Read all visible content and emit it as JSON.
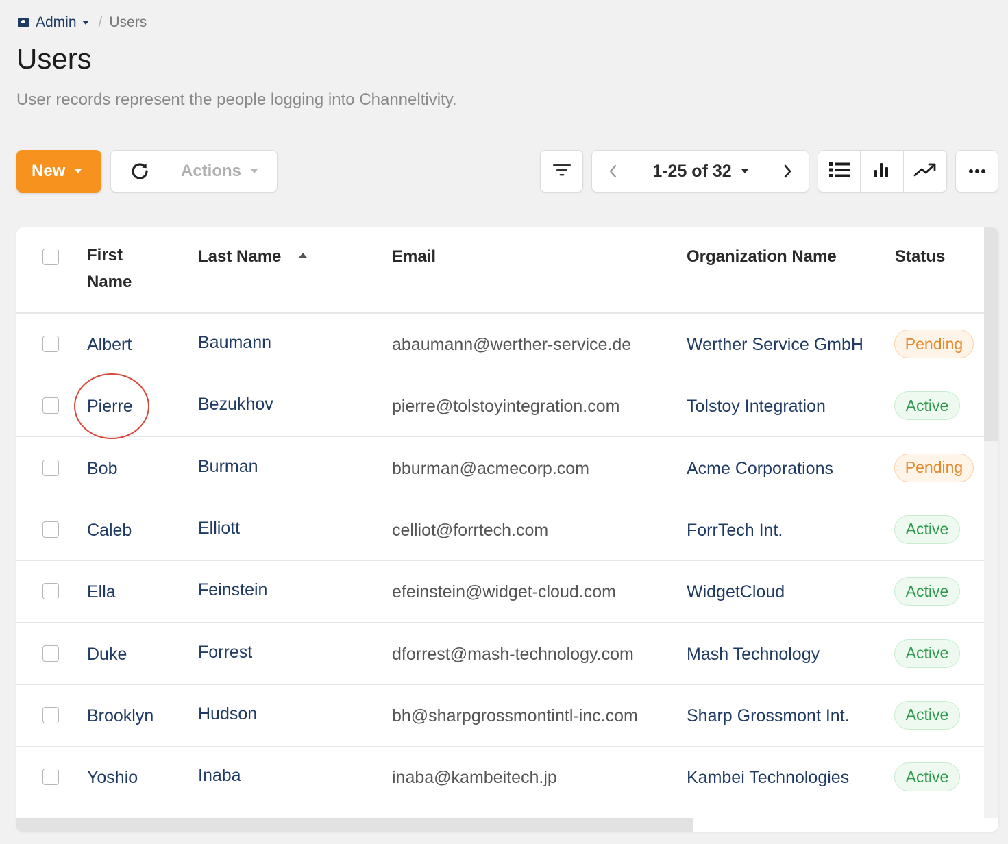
{
  "breadcrumb": {
    "parent": "Admin",
    "separator": "/",
    "current": "Users"
  },
  "page": {
    "title": "Users",
    "description": "User records represent the people logging into Channeltivity."
  },
  "toolbar": {
    "new_label": "New",
    "actions_label": "Actions",
    "pagination": "1-25 of 32"
  },
  "icons": {
    "breadcrumb": "contact-card-icon",
    "refresh": "refresh-icon",
    "filter": "filter-icon",
    "prev": "chevron-left-icon",
    "next": "chevron-right-icon",
    "list_view": "list-view-icon",
    "chart_view": "bar-chart-icon",
    "trend_view": "trend-icon",
    "more": "more-horizontal-icon"
  },
  "colors": {
    "accent": "#f7921e",
    "link": "#1f3b63",
    "pending": "#e28a2b",
    "active": "#2e9a4d",
    "highlight": "#d9473a"
  },
  "table": {
    "headers": {
      "first_name": "First Name",
      "last_name": "Last Name",
      "email": "Email",
      "organization": "Organization Name",
      "status": "Status"
    },
    "sort": {
      "column": "last_name",
      "direction": "ascending"
    },
    "rows": [
      {
        "first": "Albert",
        "last": "Baumann",
        "email": "abaumann@werther-service.de",
        "org": "Werther Service GmbH",
        "status": "Pending"
      },
      {
        "first": "Pierre",
        "last": "Bezukhov",
        "email": "pierre@tolstoyintegration.com",
        "org": "Tolstoy Integration",
        "status": "Active"
      },
      {
        "first": "Bob",
        "last": "Burman",
        "email": "bburman@acmecorp.com",
        "org": "Acme Corporations",
        "status": "Pending"
      },
      {
        "first": "Caleb",
        "last": "Elliott",
        "email": "celliot@forrtech.com",
        "org": "ForrTech Int.",
        "status": "Active"
      },
      {
        "first": "Ella",
        "last": "Feinstein",
        "email": "efeinstein@widget-cloud.com",
        "org": "WidgetCloud",
        "status": "Active"
      },
      {
        "first": "Duke",
        "last": "Forrest",
        "email": "dforrest@mash-technology.com",
        "org": "Mash Technology",
        "status": "Active"
      },
      {
        "first": "Brooklyn",
        "last": "Hudson",
        "email": "bh@sharpgrossmontintl-inc.com",
        "org": "Sharp Grossmont Int.",
        "status": "Active"
      },
      {
        "first": "Yoshio",
        "last": "Inaba",
        "email": "inaba@kambeitech.jp",
        "org": "Kambei Technologies",
        "status": "Active"
      }
    ]
  }
}
